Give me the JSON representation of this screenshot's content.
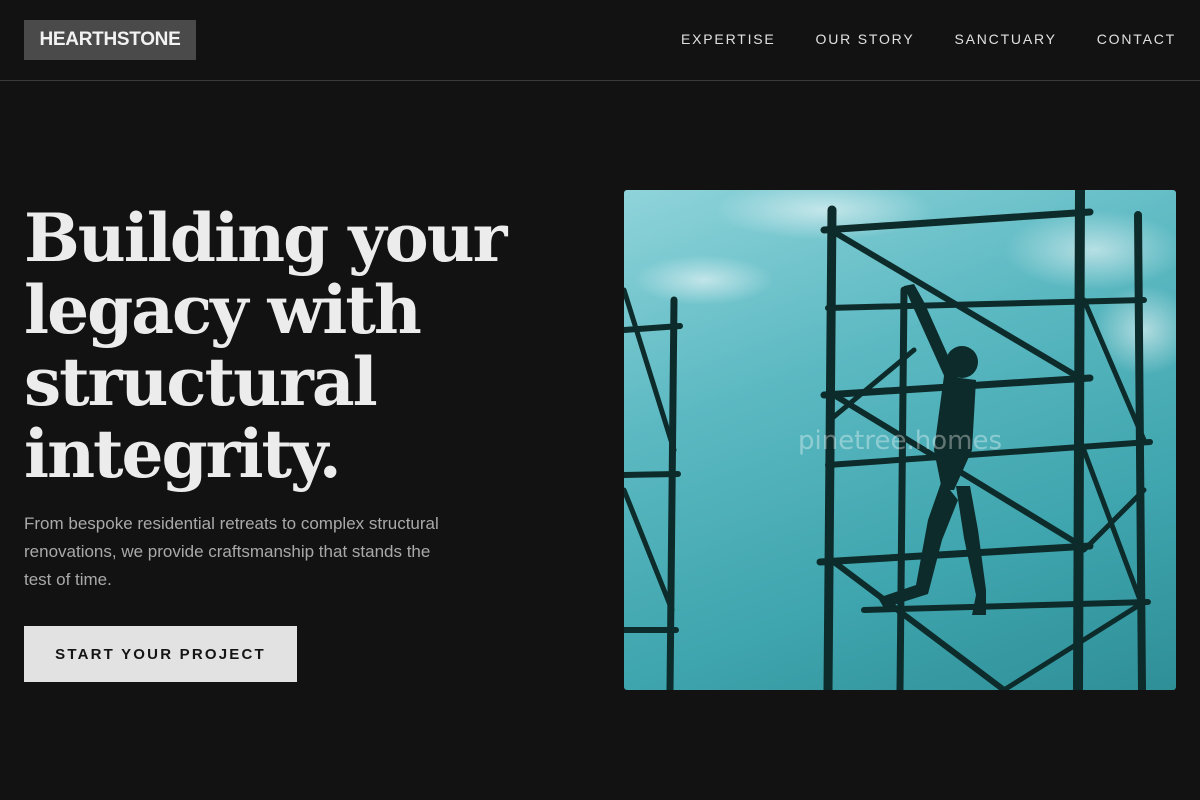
{
  "header": {
    "logo": "HEARTHSTONE",
    "nav": [
      "EXPERTISE",
      "OUR STORY",
      "SANCTUARY",
      "CONTACT"
    ]
  },
  "hero": {
    "title": "Building your legacy with structural integrity.",
    "subtitle": "From bespoke residential retreats to complex structural renovations, we provide craftsmanship that stands the test of time.",
    "cta_label": "START YOUR PROJECT"
  },
  "image": {
    "description_icon": "scaffolding-worker-photo",
    "watermark": "pinetree.homes"
  },
  "colors": {
    "background": "#121212",
    "logo_bg": "#4a4a4a",
    "cta_bg": "#e2e2e2",
    "sky": "#5cb9c2"
  }
}
